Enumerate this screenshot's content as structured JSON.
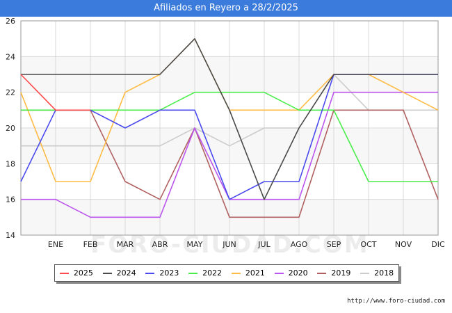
{
  "title": "Afiliados en Reyero a 28/2/2025",
  "source": "http://www.foro-ciudad.com",
  "watermark": "FORO-CIUDAD.COM",
  "chart_data": {
    "type": "line",
    "title": "Afiliados en Reyero a 28/2/2025",
    "categories": [
      "",
      "ENE",
      "FEB",
      "MAR",
      "ABR",
      "MAY",
      "JUN",
      "JUL",
      "AGO",
      "SEP",
      "OCT",
      "NOV",
      "DIC"
    ],
    "ylim": [
      14,
      26
    ],
    "yticks": [
      14,
      16,
      18,
      20,
      22,
      24,
      26
    ],
    "grid": true,
    "legend_position": "bottom",
    "series": [
      {
        "name": "2025",
        "color": "#ff4a4a",
        "values": [
          23,
          21,
          21
        ]
      },
      {
        "name": "2024",
        "color": "#4a4a4a",
        "values": [
          23,
          23,
          23,
          23,
          23,
          25,
          21,
          16,
          20,
          23,
          23,
          23,
          23
        ]
      },
      {
        "name": "2023",
        "color": "#4a4aee",
        "values": [
          17,
          21,
          21,
          20,
          21,
          21,
          16,
          17,
          17,
          23,
          23,
          23,
          23
        ]
      },
      {
        "name": "2022",
        "color": "#4aee4a",
        "values": [
          21,
          21,
          21,
          21,
          21,
          22,
          22,
          22,
          21,
          21,
          17,
          17,
          17
        ]
      },
      {
        "name": "2021",
        "color": "#ffbb44",
        "values": [
          22,
          17,
          17,
          22,
          23,
          25,
          21,
          21,
          21,
          23,
          23,
          22,
          21
        ]
      },
      {
        "name": "2020",
        "color": "#bb55ee",
        "values": [
          16,
          16,
          15,
          15,
          15,
          20,
          16,
          16,
          16,
          22,
          22,
          22,
          22
        ]
      },
      {
        "name": "2019",
        "color": "#b06060",
        "values": [
          21,
          21,
          21,
          17,
          16,
          20,
          15,
          15,
          15,
          21,
          21,
          21,
          16
        ]
      },
      {
        "name": "2018",
        "color": "#cccccc",
        "values": [
          19,
          19,
          19,
          19,
          19,
          20,
          19,
          20,
          20,
          23,
          21,
          21,
          21
        ]
      }
    ]
  }
}
